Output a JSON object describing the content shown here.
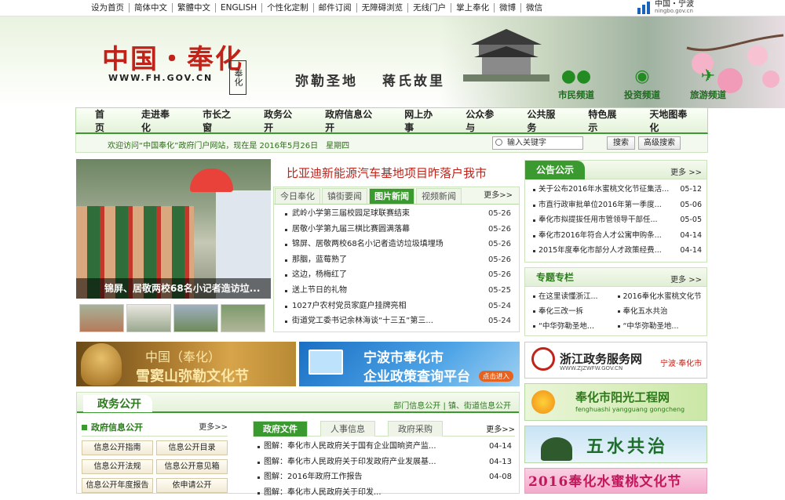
{
  "topbar": {
    "links": [
      "设为首页",
      "简体中文",
      "繁體中文",
      "ENGLISH",
      "个性化定制",
      "邮件订阅",
      "无障碍浏览",
      "无线门户",
      "掌上奉化",
      "微博",
      "微信"
    ],
    "ningbo_logo": "中国・宁波",
    "ningbo_url": "ningbo.gov.cn"
  },
  "header": {
    "site_title": "中国・奉化",
    "site_url": "WWW.FH.GOV.CN",
    "seal_text": "奉化",
    "slogan_1": "弥勒圣地",
    "slogan_2": "蒋氏故里",
    "channels": [
      {
        "label": "市民频道",
        "icon": "people-icon"
      },
      {
        "label": "投资频道",
        "icon": "globe-icon"
      },
      {
        "label": "旅游频道",
        "icon": "plane-icon"
      }
    ]
  },
  "nav": {
    "items": [
      "首 页",
      "走进奉化",
      "市长之窗",
      "政务公开",
      "政府信息公开",
      "网上办事",
      "公众参与",
      "公共服务",
      "特色展示",
      "天地图奉化"
    ]
  },
  "subbar": {
    "welcome": "欢迎访问“中国奉化”政府门户网站，现在是 2016年5月26日　星期四",
    "search_placeholder": "输入关键字",
    "search_button": "搜索",
    "advanced_button": "高级搜索"
  },
  "focus": {
    "caption": "锦屏、居敬两校68名小记者造访垃...",
    "headline": "比亚迪新能源汽车基地项目昨落户我市"
  },
  "news": {
    "tabs": [
      "今日奉化",
      "镇街要闻",
      "图片新闻",
      "视频新闻"
    ],
    "active_tab": 2,
    "more": "更多>>",
    "items": [
      {
        "title": "武岭小学第三届校园足球联赛结束",
        "date": "05-26"
      },
      {
        "title": "居敬小学第九届三棋比赛圆满落幕",
        "date": "05-26"
      },
      {
        "title": "锦屏、居敬两校68名小记者造访垃圾填埋场",
        "date": "05-26"
      },
      {
        "title": "那胭，蓝莓熟了",
        "date": "05-26"
      },
      {
        "title": "这边，杨梅红了",
        "date": "05-26"
      },
      {
        "title": "送上节日的礼物",
        "date": "05-25"
      },
      {
        "title": "1027户农村党员家庭户挂牌亮相",
        "date": "05-24"
      },
      {
        "title": "街道党工委书记余林海谈“十三五”第三...",
        "date": "05-24"
      }
    ]
  },
  "notice": {
    "title": "公告公示",
    "more": "更多 >>",
    "items": [
      {
        "title": "关于公布2016年水蜜桃文化节征集活...",
        "date": "05-12"
      },
      {
        "title": "市直行政审批单位2016年第一季度...",
        "date": "05-06"
      },
      {
        "title": "奉化市拟提拔任用市管领导干部任...",
        "date": "05-05"
      },
      {
        "title": "奉化市2016年符合人才公寓申购条...",
        "date": "04-14"
      },
      {
        "title": "2015年度奉化市部分人才政策经费...",
        "date": "04-14"
      }
    ]
  },
  "special": {
    "title": "专题专栏",
    "more": "更多 >>",
    "items": [
      "在这里读懂浙江...",
      "2016奉化水蜜桃文化节",
      "奉化三改一拆",
      "奉化五水共治",
      "“中华弥勒圣地...",
      "“中华弥勒圣地..."
    ]
  },
  "banners": {
    "b1_line1": "中国（奉化）",
    "b1_line2": "雪窦山弥勒文化节",
    "b2_line1": "宁波市奉化市",
    "b2_line2": "企业政策查询平台",
    "b2_go": "点击进入",
    "b3_title": "浙江政务服务网",
    "b3_url": "WWW.ZJZWFW.GOV.CN",
    "b3_city": "宁波·奉化市",
    "b4_title": "奉化市阳光工程网",
    "b4_pinyin": "fenghuashi yangguang gongcheng",
    "b5_title": "五水共治",
    "b6_title": "2016奉化水蜜桃文化节"
  },
  "gov": {
    "title": "政务公开",
    "links": "部门信息公开 | 镇、街道信息公开",
    "left_title": "政府信息公开",
    "left_more": "更多>>",
    "buttons": [
      "信息公开指南",
      "信息公开目录",
      "信息公开法规",
      "信息公开意见箱",
      "信息公开年度报告",
      "依申请公开"
    ],
    "tabs": [
      "政府文件",
      "人事信息",
      "政府采购"
    ],
    "active_tab": 0,
    "more": "更多>>",
    "items": [
      {
        "title": "图解：奉化市人民政府关于国有企业国晌资产监...",
        "date": "04-14"
      },
      {
        "title": "图解：奉化市人民政府关于印发政府产业发展基...",
        "date": "04-13"
      },
      {
        "title": "图解：2016年政府工作报告",
        "date": "04-08"
      },
      {
        "title": "图解：奉化市人民政府关于印发...",
        "date": ""
      }
    ]
  }
}
